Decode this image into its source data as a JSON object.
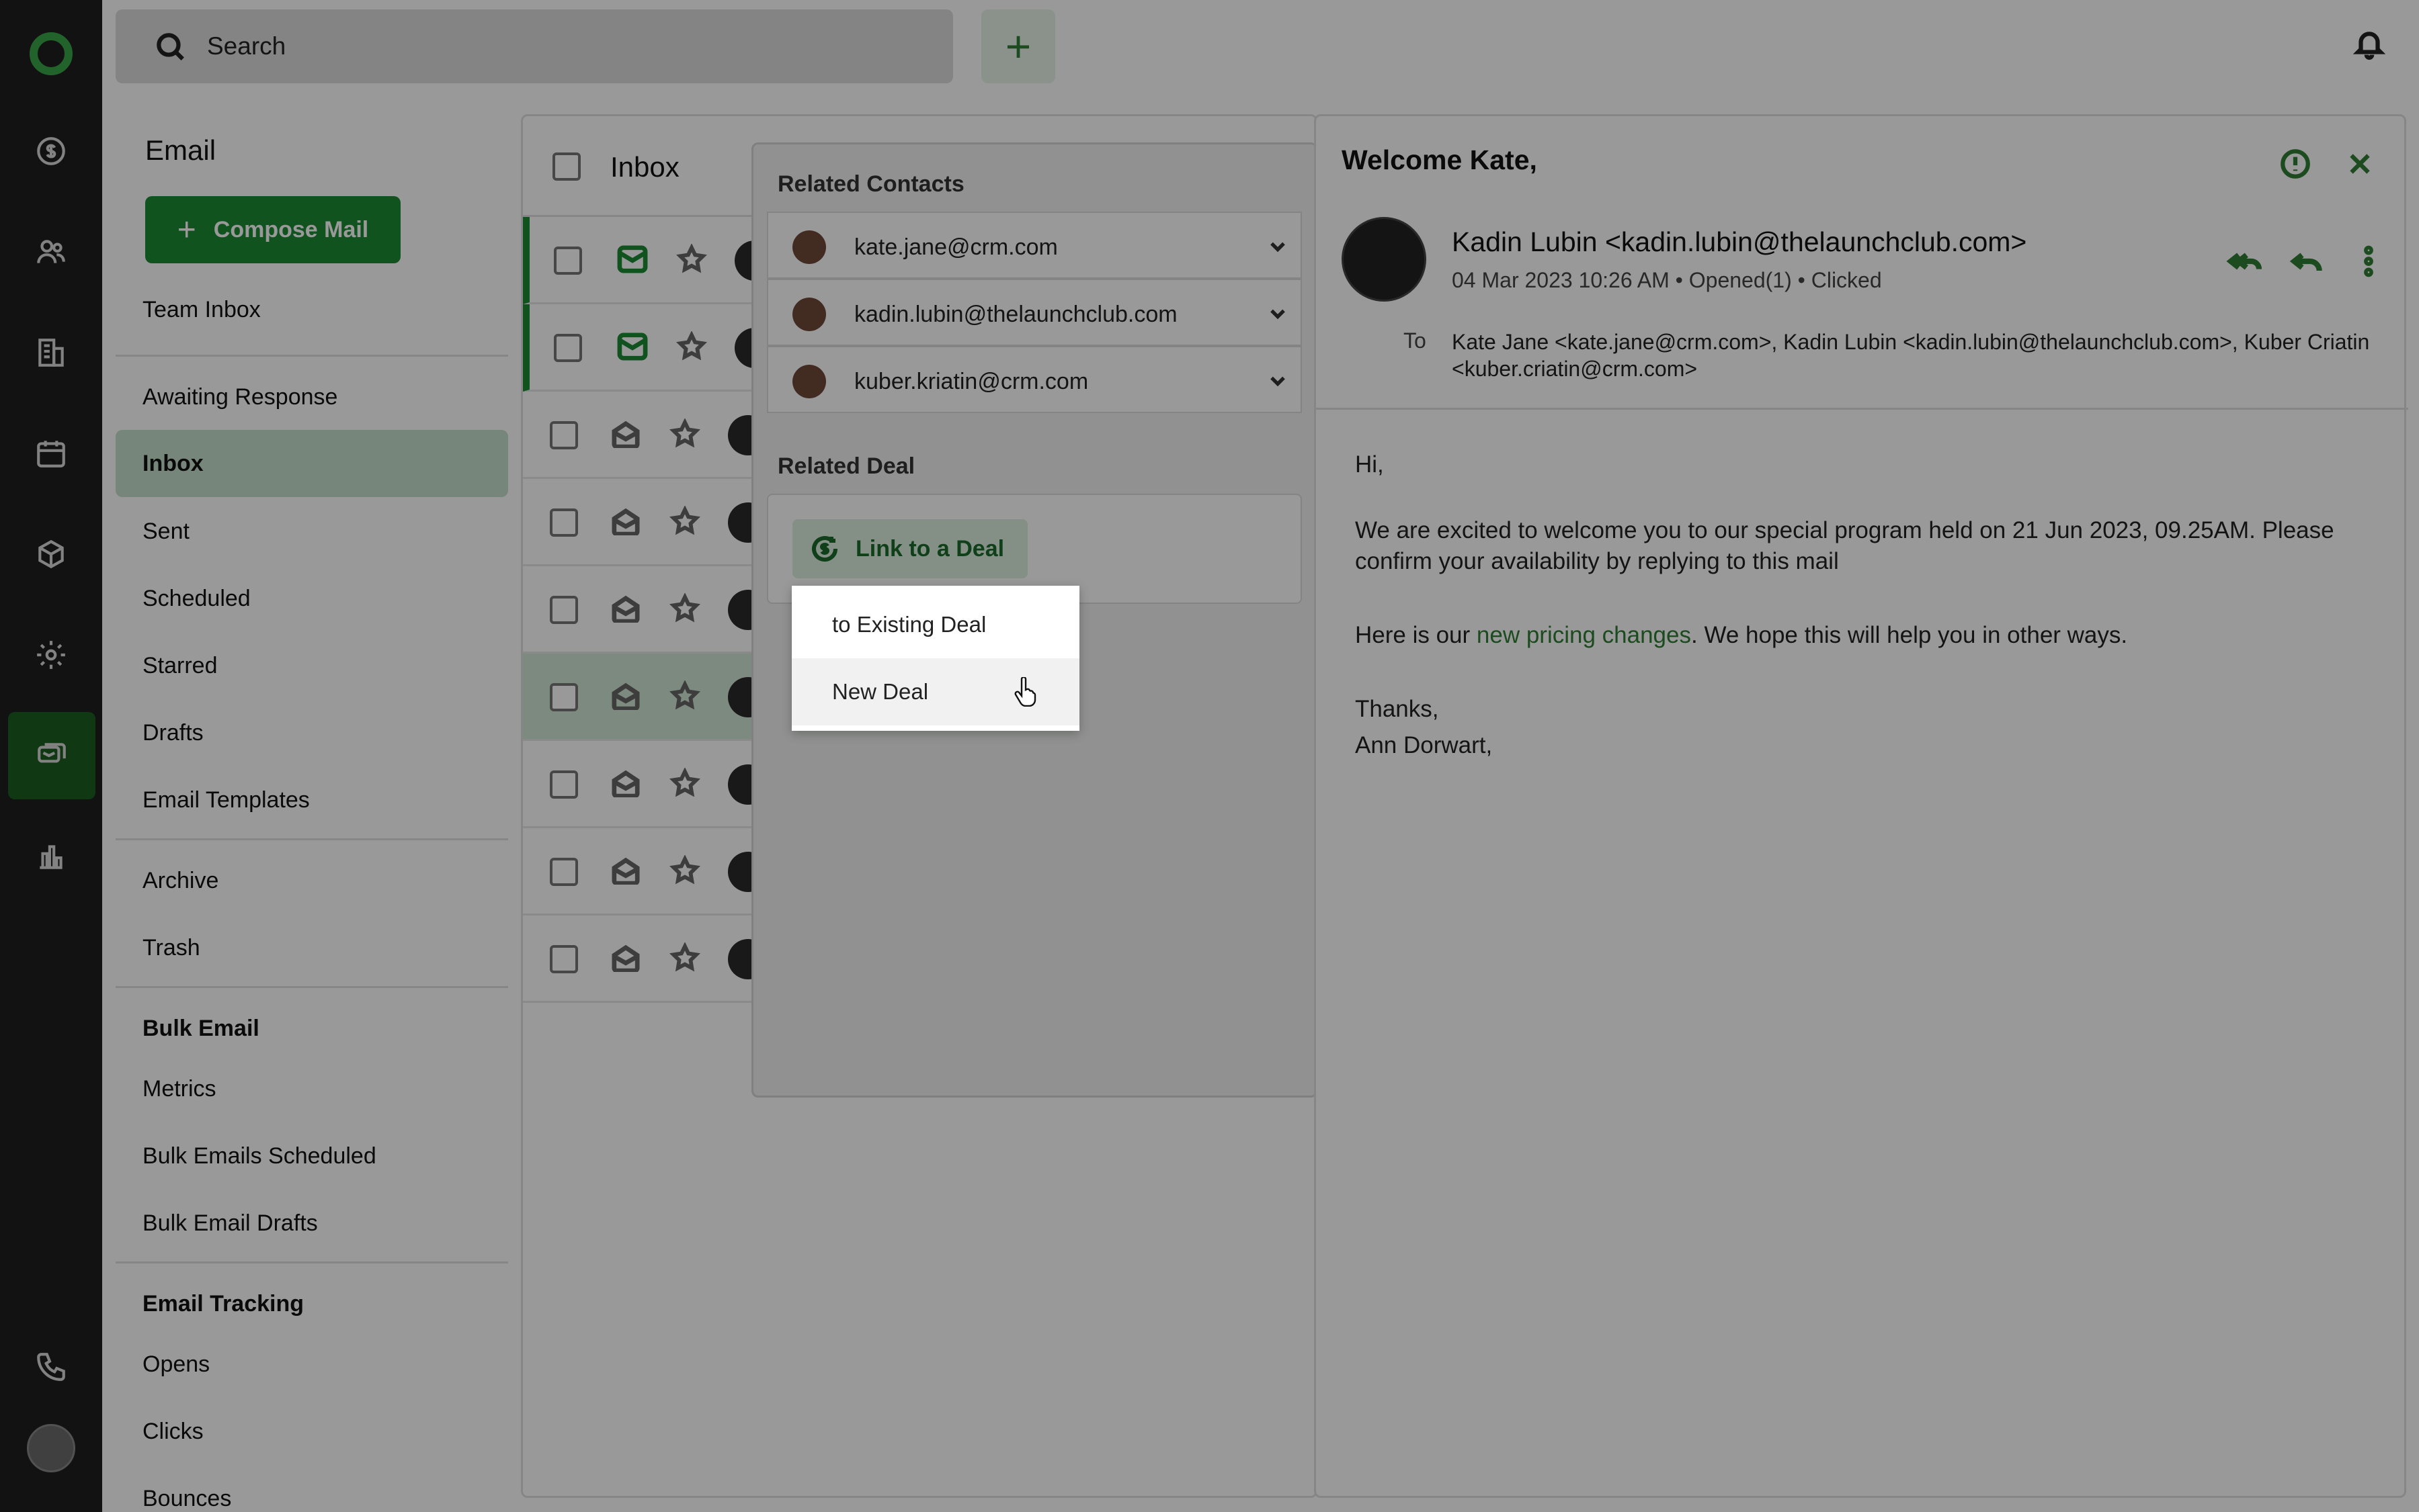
{
  "topbar": {
    "search_placeholder": "Search",
    "add_label": "+"
  },
  "email_nav": {
    "title": "Email",
    "compose_label": "Compose Mail",
    "team_inbox": "Team Inbox",
    "items": [
      "Awaiting Response",
      "Inbox",
      "Sent",
      "Scheduled",
      "Starred",
      "Drafts",
      "Email Templates"
    ],
    "archive": "Archive",
    "trash": "Trash",
    "bulk_heading": "Bulk Email",
    "bulk_items": [
      "Metrics",
      "Bulk Emails Scheduled",
      "Bulk Email Drafts"
    ],
    "tracking_heading": "Email Tracking",
    "tracking_items": [
      "Opens",
      "Clicks",
      "Bounces"
    ]
  },
  "list": {
    "title": "Inbox"
  },
  "related": {
    "contacts_title": "Related Contacts",
    "contacts": [
      "kate.jane@crm.com",
      "kadin.lubin@thelaunchclub.com",
      "kuber.kriatin@crm.com"
    ],
    "deal_title": "Related Deal",
    "link_deal_label": "Link to a Deal"
  },
  "deal_menu": {
    "items": [
      "to Existing Deal",
      "New Deal"
    ]
  },
  "reader": {
    "subject": "Welcome Kate,",
    "sender": "Kadin Lubin <kadin.lubin@thelaunchclub.com>",
    "meta": "04 Mar 2023 10:26 AM  •  Opened(1)  •  Clicked",
    "to_label": "To",
    "to_value": "Kate Jane <kate.jane@crm.com>, Kadin Lubin <kadin.lubin@thelaunchclub.com>, Kuber Criatin <kuber.criatin@crm.com>",
    "greeting": "Hi,",
    "para1": "We are excited to welcome you to our special program held on 21 Jun 2023, 09.25AM. Please confirm your availability by replying to this mail",
    "para2_prefix": "Here is our ",
    "para2_link": "new pricing changes",
    "para2_suffix": ". We hope this will help you in other ways.",
    "signoff": "Thanks,",
    "signature": "Ann Dorwart,"
  },
  "colors": {
    "accent": "#1b8a34",
    "rail": "#1e1e1e"
  }
}
